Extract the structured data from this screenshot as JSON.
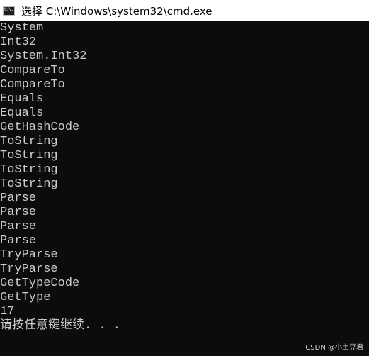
{
  "window": {
    "title": "选择 C:\\Windows\\system32\\cmd.exe",
    "icon_name": "cmd-app-icon",
    "icon_text": "C:\\."
  },
  "console": {
    "lines": [
      "System",
      "Int32",
      "System.Int32",
      "CompareTo",
      "CompareTo",
      "Equals",
      "Equals",
      "GetHashCode",
      "ToString",
      "ToString",
      "ToString",
      "ToString",
      "Parse",
      "Parse",
      "Parse",
      "Parse",
      "TryParse",
      "TryParse",
      "GetTypeCode",
      "GetType",
      "17",
      "请按任意键继续. . ."
    ]
  },
  "watermark": {
    "text": "CSDN @小土豆君"
  },
  "colors": {
    "console_bg": "#0c0c0c",
    "console_fg": "#cccccc",
    "titlebar_bg": "#ffffff"
  }
}
